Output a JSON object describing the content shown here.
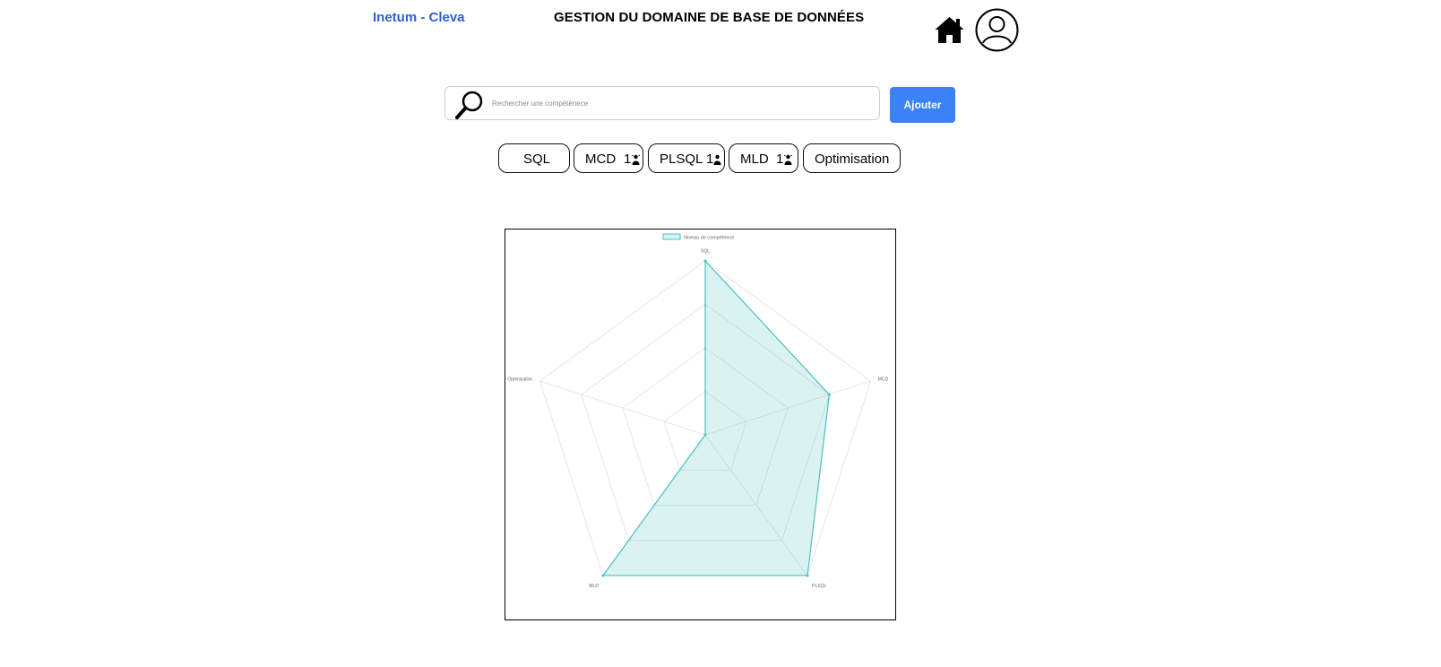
{
  "header": {
    "brand": "Inetum - Cleva",
    "title": "GESTION DU DOMAINE DE BASE DE DONNÉES"
  },
  "search": {
    "placeholder": "Rechercher une compétènece",
    "value": "",
    "add_label": "Ajouter"
  },
  "chips": [
    {
      "label": "SQL",
      "count": ""
    },
    {
      "label": "MCD",
      "count": "1"
    },
    {
      "label": "PLSQL",
      "count": "1"
    },
    {
      "label": "MLD",
      "count": "1"
    },
    {
      "label": "Optimisation",
      "count": ""
    }
  ],
  "colors": {
    "brand": "#2f5fd0",
    "accent": "#3b82f6",
    "series_stroke": "#4bc0c0",
    "series_fill": "rgba(75,192,192,0.2)",
    "grid": "#e6e6e6"
  },
  "icons": {
    "home": "home-icon",
    "avatar": "user-circle-icon",
    "search": "magnifier-icon",
    "chip_user": "user-icon"
  },
  "chart_data": {
    "type": "radar",
    "labels": [
      "SQL",
      "MCD",
      "PLSQL",
      "MLD",
      "Optimisation"
    ],
    "series": [
      {
        "name": "Niveau de compétence",
        "values": [
          4,
          3,
          4,
          4,
          0
        ]
      }
    ],
    "r_range": [
      0,
      4
    ],
    "tick_labels": [
      "1",
      "2",
      "3"
    ],
    "legend_position": "top",
    "grid": true
  }
}
